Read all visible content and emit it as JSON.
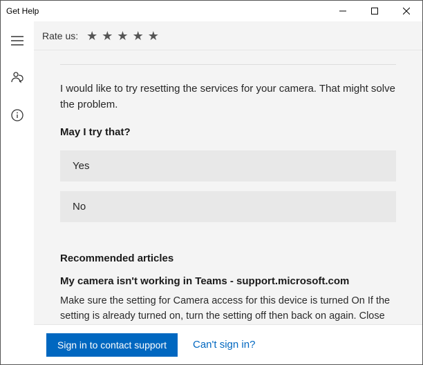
{
  "window": {
    "title": "Get Help"
  },
  "rate": {
    "label": "Rate us:"
  },
  "conversation": {
    "message": "I would like to try resetting the services for your camera. That might solve the problem.",
    "question": "May I try that?",
    "options": [
      "Yes",
      "No"
    ]
  },
  "recommended": {
    "heading": "Recommended articles",
    "article_title": "My camera isn't working in Teams - support.microsoft.com",
    "article_body": "Make sure the setting for Camera access for this device is turned On If the setting is already turned on, turn the setting off then back on again. Close all apps and restart your device. Check your drivers. When your camera"
  },
  "footer": {
    "signin_label": "Sign in to contact support",
    "cant_signin_label": "Can't sign in?"
  }
}
